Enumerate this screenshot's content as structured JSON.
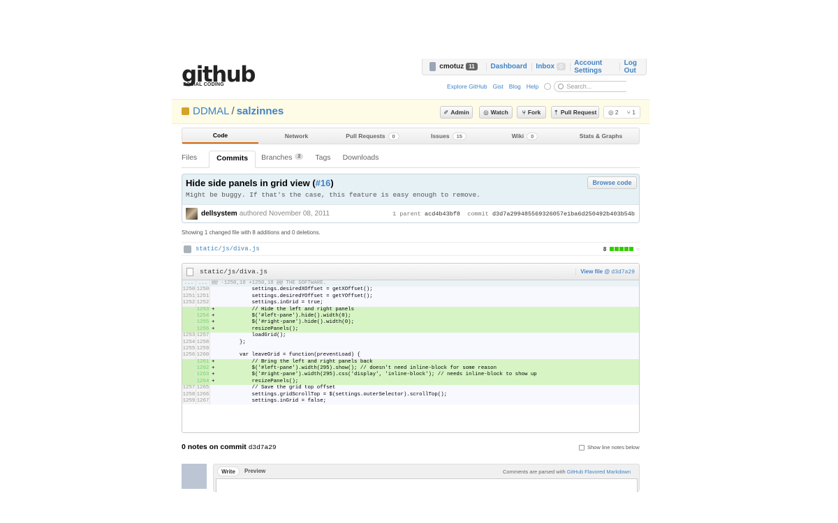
{
  "header": {
    "logo_word": "github",
    "logo_tagline": "SOCIAL CODING",
    "user": {
      "name": "cmotuz",
      "count": "11"
    },
    "topnav": [
      {
        "label": "Dashboard"
      },
      {
        "label": "Inbox",
        "count": "0"
      },
      {
        "label": "Account Settings"
      },
      {
        "label": "Log Out"
      }
    ],
    "subnav": [
      "Explore GitHub",
      "Gist",
      "Blog",
      "Help"
    ],
    "search_placeholder": "Search..."
  },
  "repo": {
    "owner": "DDMAL",
    "separator": "/",
    "name": "salzinnes",
    "buttons": {
      "admin": "Admin",
      "watch": "Watch",
      "fork": "Fork",
      "pull_request": "Pull Request"
    },
    "watchers": "2",
    "forks": "1"
  },
  "tabs": [
    {
      "label": "Code",
      "count": ""
    },
    {
      "label": "Network",
      "count": ""
    },
    {
      "label": "Pull Requests",
      "count": "0"
    },
    {
      "label": "Issues",
      "count": "15"
    },
    {
      "label": "Wiki",
      "count": "0"
    },
    {
      "label": "Stats & Graphs",
      "count": ""
    }
  ],
  "subtabs": [
    {
      "label": "Files",
      "count": ""
    },
    {
      "label": "Commits",
      "count": ""
    },
    {
      "label": "Branches",
      "count": "2"
    },
    {
      "label": "Tags",
      "count": ""
    },
    {
      "label": "Downloads",
      "count": ""
    }
  ],
  "commit": {
    "title": "Hide side panels in grid view (",
    "issue_link": "#16",
    "title_end": ")",
    "description": "Might be buggy. If that's the case, this feature is easy enough to remove.",
    "browse_label": "Browse code",
    "author": "dellsystem",
    "authored": "authored November 08, 2011",
    "parent_label": "1 parent",
    "parent_hash": "acd4b43bf8",
    "commit_label": "commit",
    "commit_hash": "d3d7a299485569326057e1ba6d250492b403b54b"
  },
  "summary": "Showing 1 changed file with 8 additions and 0 deletions.",
  "file_list": {
    "name": "static/js/diva.js",
    "additions": "8",
    "tail": "="
  },
  "diff": {
    "file": "static/js/diva.js",
    "view_label": "View file @",
    "view_hash": "d3d7a29",
    "lines": [
      {
        "t": "hunk",
        "a": "...",
        "b": "...",
        "code": "@@ -1250,10 +1250,18 @@ THE SOFTWARE."
      },
      {
        "t": "ctx",
        "a": "1250",
        "b": "1250",
        "code": "             settings.desiredXOffset = getXOffset();"
      },
      {
        "t": "ctx",
        "a": "1251",
        "b": "1251",
        "code": "             settings.desiredYOffset = getYOffset();"
      },
      {
        "t": "ctx",
        "a": "1252",
        "b": "1252",
        "code": "             settings.inGrid = true;"
      },
      {
        "t": "add",
        "a": "",
        "b": "1253",
        "code": "+            // Hide the left and right panels"
      },
      {
        "t": "add",
        "a": "",
        "b": "1254",
        "code": "+            $('#left-pane').hide().width(0);"
      },
      {
        "t": "add",
        "a": "",
        "b": "1255",
        "code": "+            $('#right-pane').hide().width(0);"
      },
      {
        "t": "add",
        "a": "",
        "b": "1256",
        "code": "+            resizePanels();"
      },
      {
        "t": "ctx",
        "a": "1253",
        "b": "1257",
        "code": "             loadGrid();"
      },
      {
        "t": "ctx",
        "a": "1254",
        "b": "1258",
        "code": "         };"
      },
      {
        "t": "ctx",
        "a": "1255",
        "b": "1259",
        "code": ""
      },
      {
        "t": "ctx",
        "a": "1256",
        "b": "1260",
        "code": "         var leaveGrid = function(preventLoad) {"
      },
      {
        "t": "add",
        "a": "",
        "b": "1261",
        "code": "+            // Bring the left and right panels back"
      },
      {
        "t": "add",
        "a": "",
        "b": "1262",
        "code": "+            $('#left-pane').width(295).show(); // doesn't need inline-block for some reason"
      },
      {
        "t": "add",
        "a": "",
        "b": "1263",
        "code": "+            $('#right-pane').width(295).css('display', 'inline-block'); // needs inline-block to show up"
      },
      {
        "t": "add",
        "a": "",
        "b": "1264",
        "code": "+            resizePanels();"
      },
      {
        "t": "ctx",
        "a": "1257",
        "b": "1265",
        "code": "             // Save the grid top offset"
      },
      {
        "t": "ctx",
        "a": "1258",
        "b": "1266",
        "code": "             settings.gridScrollTop = $(settings.outerSelector).scrollTop();"
      },
      {
        "t": "ctx",
        "a": "1259",
        "b": "1267",
        "code": "             settings.inGrid = false;"
      }
    ]
  },
  "notes": {
    "title": "0 notes on commit",
    "hash": "d3d7a29",
    "show_line_notes": "Show line notes below",
    "write": "Write",
    "preview": "Preview",
    "parsed_prefix": "Comments are parsed with",
    "parsed_link": "GitHub Flavored Markdown"
  }
}
